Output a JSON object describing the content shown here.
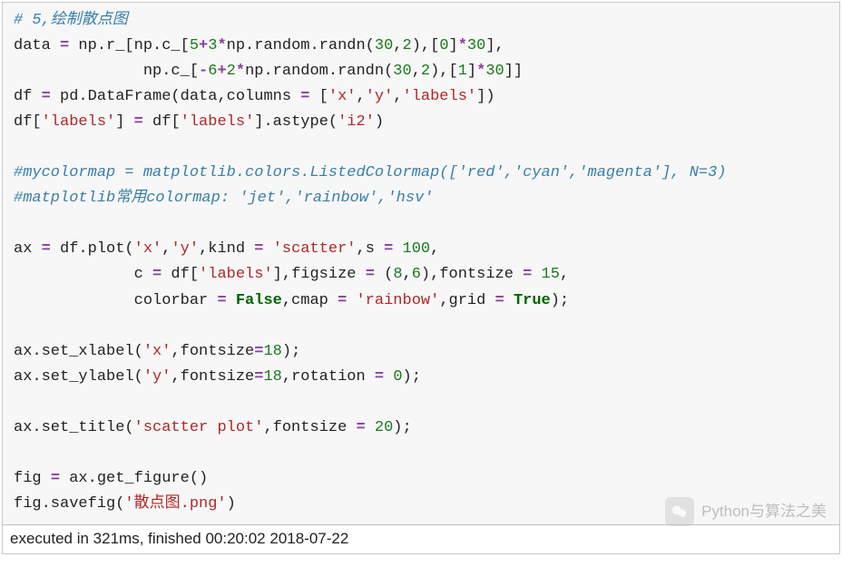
{
  "code": {
    "line1_comment": "# 5,绘制散点图",
    "l2": {
      "a": "data ",
      "b": "=",
      "c": " np.r_[np.c_[",
      "n1": "5",
      "op1": "+",
      "n2": "3",
      "star1": "*",
      "d": "np.random.randn(",
      "n3": "30",
      "comma1": ",",
      "n4": "2",
      "e": "),[",
      "n5": "0",
      "f": "]",
      "star2": "*",
      "n6": "30",
      "g": "],"
    },
    "l3": {
      "pad": "              np.c_[",
      "op1": "-",
      "n1": "6",
      "op2": "+",
      "n2": "2",
      "star": "*",
      "a": "np.random.randn(",
      "n3": "30",
      "c1": ",",
      "n4": "2",
      "b": "),[",
      "n5": "1",
      "c": "]",
      "star2": "*",
      "n6": "30",
      "d": "]]"
    },
    "l4": {
      "a": "df ",
      "eq": "=",
      "b": " pd.DataFrame(data,columns ",
      "eq2": "=",
      "c": " [",
      "s1": "'x'",
      "d": ",",
      "s2": "'y'",
      "e": ",",
      "s3": "'labels'",
      "f": "])"
    },
    "l5": {
      "a": "df[",
      "s1": "'labels'",
      "b": "] ",
      "eq": "=",
      "c": " df[",
      "s2": "'labels'",
      "d": "].astype(",
      "s3": "'i2'",
      "e": ")"
    },
    "l7_comment": "#mycolormap = matplotlib.colors.ListedColormap(['red','cyan','magenta'], N=3)",
    "l8_comment": "#matplotlib常用colormap: 'jet','rainbow','hsv'",
    "l10": {
      "a": "ax ",
      "eq": "=",
      "b": " df.plot(",
      "s1": "'x'",
      "c": ",",
      "s2": "'y'",
      "d": ",kind ",
      "eq2": "=",
      "e": " ",
      "s3": "'scatter'",
      "f": ",s ",
      "eq3": "=",
      "g": " ",
      "n1": "100",
      "h": ","
    },
    "l11": {
      "pad": "             c ",
      "eq": "=",
      "a": " df[",
      "s1": "'labels'",
      "b": "],figsize ",
      "eq2": "=",
      "c": " (",
      "n1": "8",
      "d": ",",
      "n2": "6",
      "e": "),fontsize ",
      "eq3": "=",
      "f": " ",
      "n3": "15",
      "g": ","
    },
    "l12": {
      "pad": "             colorbar ",
      "eq": "=",
      "sp": " ",
      "kw1": "False",
      "a": ",cmap ",
      "eq2": "=",
      "b": " ",
      "s1": "'rainbow'",
      "c": ",grid ",
      "eq3": "=",
      "d": " ",
      "kw2": "True",
      "e": ");"
    },
    "l14": {
      "a": "ax.set_xlabel(",
      "s1": "'x'",
      "b": ",fontsize",
      "eq": "=",
      "n1": "18",
      "c": ");"
    },
    "l15": {
      "a": "ax.set_ylabel(",
      "s1": "'y'",
      "b": ",fontsize",
      "eq": "=",
      "n1": "18",
      "c": ",rotation ",
      "eq2": "=",
      "d": " ",
      "n2": "0",
      "e": ");"
    },
    "l17": {
      "a": "ax.set_title(",
      "s1": "'scatter plot'",
      "b": ",fontsize ",
      "eq": "=",
      "c": " ",
      "n1": "20",
      "d": ");"
    },
    "l19": {
      "a": "fig ",
      "eq": "=",
      "b": " ax.get_figure()"
    },
    "l20": {
      "a": "fig.savefig(",
      "s1": "'散点图.png'",
      "b": ")"
    }
  },
  "status": "executed in 321ms, finished 00:20:02 2018-07-22",
  "watermark": "Python与算法之美"
}
